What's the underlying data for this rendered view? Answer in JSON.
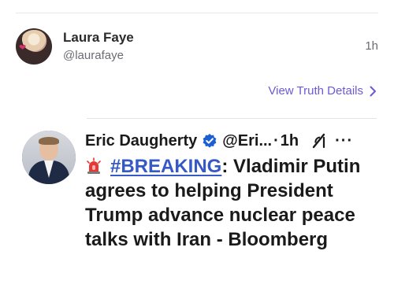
{
  "post": {
    "author_name": "Laura Faye",
    "author_handle": "@laurafaye",
    "time": "1h",
    "view_details_label": "View Truth Details"
  },
  "tweet": {
    "author_name": "Eric Daugherty",
    "author_handle": "@Eri...",
    "separator": "·",
    "time": "1h",
    "more_label": "···",
    "hashtag": "#BREAKING",
    "text_rest": ": Vladimir Putin agrees to helping President Trump advance nuclear peace talks with Iran - Bloomberg"
  },
  "colors": {
    "link_purple": "#6b5bd2",
    "hashtag_blue": "#3559c7",
    "verified_blue": "#1d5fd1"
  },
  "icons": {
    "verified": "verified-badge-icon",
    "grok": "grok-icon",
    "siren": "siren-icon",
    "chevron": "chevron-right-icon"
  }
}
